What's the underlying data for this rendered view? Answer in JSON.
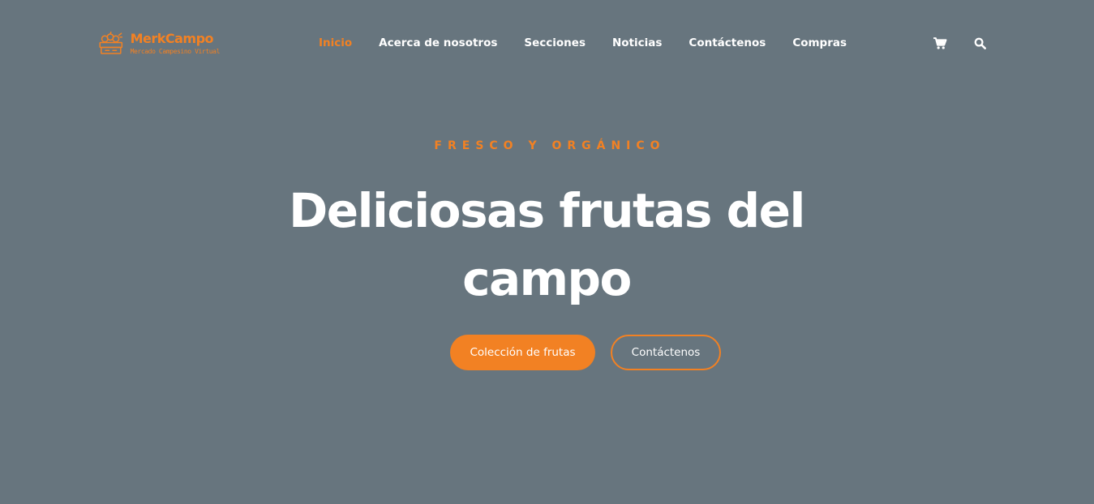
{
  "brand": {
    "name": "MerkCampo",
    "tagline": "Mercado Campesino Virtual",
    "icon": "fruit-crate-icon",
    "color": "#f28123"
  },
  "nav": {
    "items": [
      {
        "label": "Inicio",
        "active": true
      },
      {
        "label": "Acerca de nosotros",
        "active": false
      },
      {
        "label": "Secciones",
        "active": false
      },
      {
        "label": "Noticias",
        "active": false
      },
      {
        "label": "Contáctenos",
        "active": false
      },
      {
        "label": "Compras",
        "active": false
      }
    ],
    "active_color": "#f28123"
  },
  "header_icons": {
    "cart": "cart-icon",
    "search": "search-icon"
  },
  "hero": {
    "subtitle": "FRESCO Y ORGÁNICO",
    "title": "Deliciosas frutas del campo",
    "buttons": {
      "primary": "Colección de frutas",
      "secondary": "Contáctenos"
    }
  },
  "colors": {
    "background": "#67757e",
    "accent": "#f28123",
    "text": "#ffffff"
  }
}
